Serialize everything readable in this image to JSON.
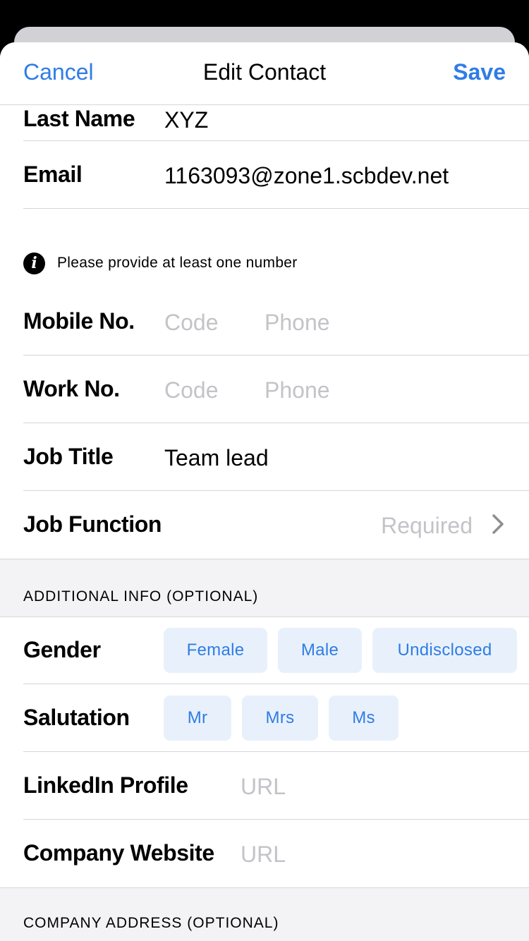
{
  "nav": {
    "cancel": "Cancel",
    "title": "Edit Contact",
    "save": "Save"
  },
  "fields": {
    "last_name": {
      "label": "Last Name",
      "value": "XYZ"
    },
    "email": {
      "label": "Email",
      "value": "1163093@zone1.scbdev.net"
    },
    "info_text": "Please provide at least one number",
    "mobile": {
      "label": "Mobile No.",
      "code_placeholder": "Code",
      "phone_placeholder": "Phone"
    },
    "work": {
      "label": "Work No.",
      "code_placeholder": "Code",
      "phone_placeholder": "Phone"
    },
    "job_title": {
      "label": "Job Title",
      "value": "Team lead"
    },
    "job_function": {
      "label": "Job Function",
      "placeholder": "Required"
    }
  },
  "additional": {
    "header": "ADDITIONAL INFO (OPTIONAL)",
    "gender": {
      "label": "Gender",
      "options": [
        "Female",
        "Male",
        "Undisclosed"
      ]
    },
    "salutation": {
      "label": "Salutation",
      "options": [
        "Mr",
        "Mrs",
        "Ms"
      ]
    },
    "linkedin": {
      "label": "LinkedIn Profile",
      "placeholder": "URL"
    },
    "website": {
      "label": "Company Website",
      "placeholder": "URL"
    }
  },
  "company_address": {
    "header": "COMPANY ADDRESS (OPTIONAL)"
  },
  "colors": {
    "accent": "#2f7ce6",
    "pill_bg": "#e8f1fb",
    "section_bg": "#f3f3f5",
    "placeholder": "#c3c3c8"
  },
  "icons": {
    "info": "info-icon",
    "chevron": "chevron-right-icon"
  }
}
